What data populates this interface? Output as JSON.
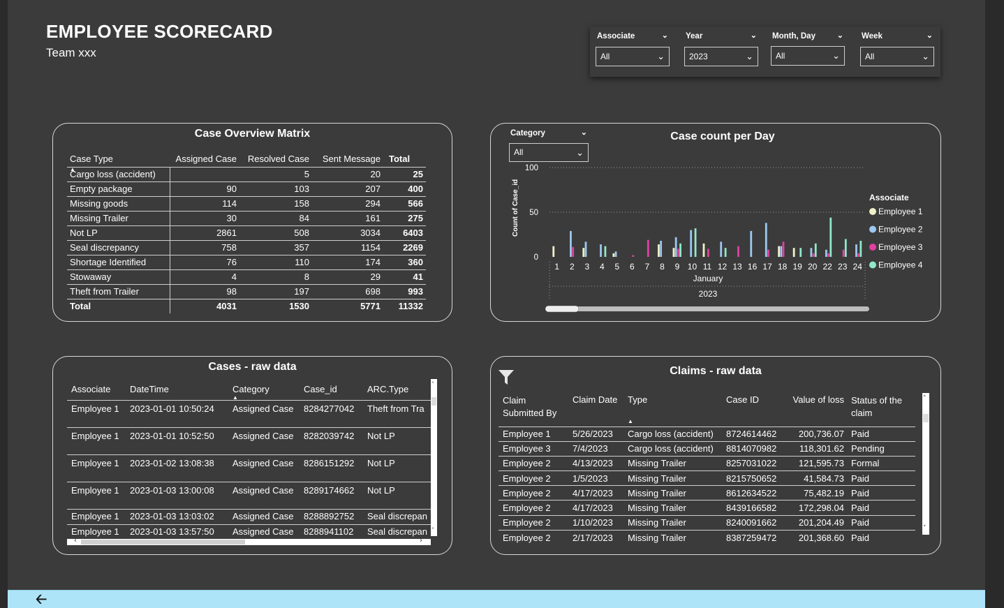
{
  "header": {
    "title": "EMPLOYEE SCORECARD",
    "subtitle": "Team xxx"
  },
  "slicers": [
    {
      "label": "Associate",
      "value": "All"
    },
    {
      "label": "Year",
      "value": "2023"
    },
    {
      "label": "Month, Day",
      "value": "All"
    },
    {
      "label": "Week",
      "value": "All"
    }
  ],
  "matrix": {
    "title": "Case Overview Matrix",
    "columns": [
      "Case Type",
      "Assigned Case",
      "Resolved Case",
      "Sent Message",
      "Total"
    ],
    "rows": [
      [
        "Cargo loss (accident)",
        "",
        "5",
        "20",
        "25"
      ],
      [
        "Empty package",
        "90",
        "103",
        "207",
        "400"
      ],
      [
        "Missing goods",
        "114",
        "158",
        "294",
        "566"
      ],
      [
        "Missing Trailer",
        "30",
        "84",
        "161",
        "275"
      ],
      [
        "Not LP",
        "2861",
        "508",
        "3034",
        "6403"
      ],
      [
        "Seal discrepancy",
        "758",
        "357",
        "1154",
        "2269"
      ],
      [
        "Shortage Identified",
        "76",
        "110",
        "174",
        "360"
      ],
      [
        "Stowaway",
        "4",
        "8",
        "29",
        "41"
      ],
      [
        "Theft from Trailer",
        "98",
        "197",
        "698",
        "993"
      ]
    ],
    "total": [
      "Total",
      "4031",
      "1530",
      "5771",
      "11332"
    ]
  },
  "chart": {
    "title": "Case count per Day",
    "category_slicer": {
      "label": "Category",
      "value": "All"
    },
    "ylabel": "Count of Case_id",
    "month_label": "January",
    "year_label": "2023",
    "legend_title": "Associate"
  },
  "chart_data": {
    "type": "bar",
    "categories": [
      "1",
      "2",
      "3",
      "4",
      "5",
      "6",
      "7",
      "8",
      "9",
      "10",
      "11",
      "12",
      "13",
      "16",
      "17",
      "18",
      "19",
      "20",
      "22",
      "23",
      "24"
    ],
    "ylim": [
      0,
      100
    ],
    "yticks": [
      "0",
      "50",
      "100"
    ],
    "series": [
      {
        "name": "Employee 1",
        "color": "#f0f0c8",
        "values": [
          12,
          0,
          10,
          0,
          4,
          0,
          0,
          14,
          10,
          0,
          15,
          0,
          0,
          0,
          0,
          12,
          10,
          0,
          0,
          0,
          0
        ]
      },
      {
        "name": "Employee 2",
        "color": "#9cc8f0",
        "values": [
          0,
          29,
          17,
          14,
          6,
          0,
          0,
          18,
          22,
          30,
          0,
          17,
          0,
          29,
          38,
          12,
          0,
          10,
          8,
          0,
          14
        ]
      },
      {
        "name": "Employee 3",
        "color": "#e040a0",
        "values": [
          0,
          11,
          0,
          0,
          0,
          2,
          19,
          0,
          9,
          0,
          9,
          0,
          12,
          0,
          8,
          17,
          0,
          4,
          4,
          8,
          4
        ]
      },
      {
        "name": "Employee 4",
        "color": "#90e8c8",
        "values": [
          0,
          0,
          0,
          12,
          0,
          0,
          0,
          0,
          15,
          32,
          0,
          10,
          0,
          0,
          0,
          0,
          10,
          15,
          44,
          20,
          18
        ]
      }
    ]
  },
  "cases_raw": {
    "title": "Cases - raw data",
    "columns": [
      "Associate",
      "DateTime",
      "Category",
      "Case_id",
      "ARC.Type"
    ],
    "rows": [
      [
        "Employee 1",
        "2023-01-01 10:50:24",
        "Assigned Case",
        "8284277042",
        "Theft from Tra"
      ],
      [
        "Employee 1",
        "2023-01-01 10:52:50",
        "Assigned Case",
        "8282039742",
        "Not LP"
      ],
      [
        "Employee 1",
        "2023-01-02 13:08:38",
        "Assigned Case",
        "8286151292",
        "Not LP"
      ],
      [
        "Employee 1",
        "2023-01-03 13:00:08",
        "Assigned Case",
        "8289174662",
        "Not LP"
      ],
      [
        "Employee 1",
        "2023-01-03 13:03:02",
        "Assigned Case",
        "8288892752",
        "Seal discrepan"
      ],
      [
        "Employee 1",
        "2023-01-03 13:57:50",
        "Assigned Case",
        "8288941102",
        "Seal discrepan"
      ]
    ]
  },
  "claims_raw": {
    "title": "Claims - raw data",
    "columns": [
      "Claim Submitted By",
      "Claim Date",
      "Type",
      "Case ID",
      "Value of loss",
      "Status of the claim"
    ],
    "rows": [
      [
        "Employee 1",
        "5/26/2023",
        "Cargo loss (accident)",
        "8724614462",
        "200,736.07",
        "Paid"
      ],
      [
        "Employee 3",
        "7/4/2023",
        "Cargo loss (accident)",
        "8814070982",
        "118,301.62",
        "Pending"
      ],
      [
        "Employee 2",
        "4/13/2023",
        "Missing Trailer",
        "8257031022",
        "121,595.73",
        "Formal"
      ],
      [
        "Employee 2",
        "1/5/2023",
        "Missing Trailer",
        "8215750652",
        "41,584.73",
        "Paid"
      ],
      [
        "Employee 2",
        "4/17/2023",
        "Missing Trailer",
        "8612634522",
        "75,482.19",
        "Paid"
      ],
      [
        "Employee 2",
        "4/17/2023",
        "Missing Trailer",
        "8439166582",
        "172,298.04",
        "Paid"
      ],
      [
        "Employee 2",
        "1/10/2023",
        "Missing Trailer",
        "8240091662",
        "201,204.49",
        "Paid"
      ],
      [
        "Employee 2",
        "2/17/2023",
        "Missing Trailer",
        "8387259472",
        "201,368.60",
        "Paid"
      ]
    ]
  }
}
